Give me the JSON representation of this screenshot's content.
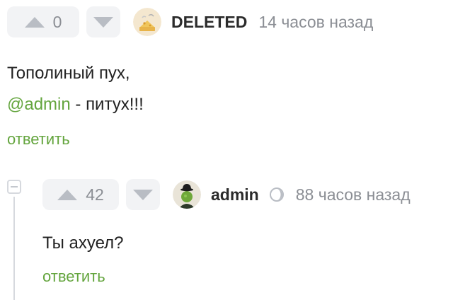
{
  "comments": [
    {
      "rating": "0",
      "author": "DELETED",
      "time": "14 часов назад",
      "text_line1": "Тополиный пух,",
      "mention": "@admin",
      "text_line2_rest": " - питух!!!",
      "reply_label": "ответить",
      "avatar_icon": "deleted-user-avatar"
    },
    {
      "rating": "42",
      "author": "admin",
      "time": "88 часов назад",
      "text_line1": "Ты ахуел?",
      "reply_label": "ответить",
      "avatar_icon": "bowler-hat-apple-avatar",
      "badge_icon": "moon-icon"
    }
  ],
  "colors": {
    "link_green": "#64a53e",
    "vote_bg": "#f2f3f5",
    "muted_gray": "#8b8e94"
  }
}
